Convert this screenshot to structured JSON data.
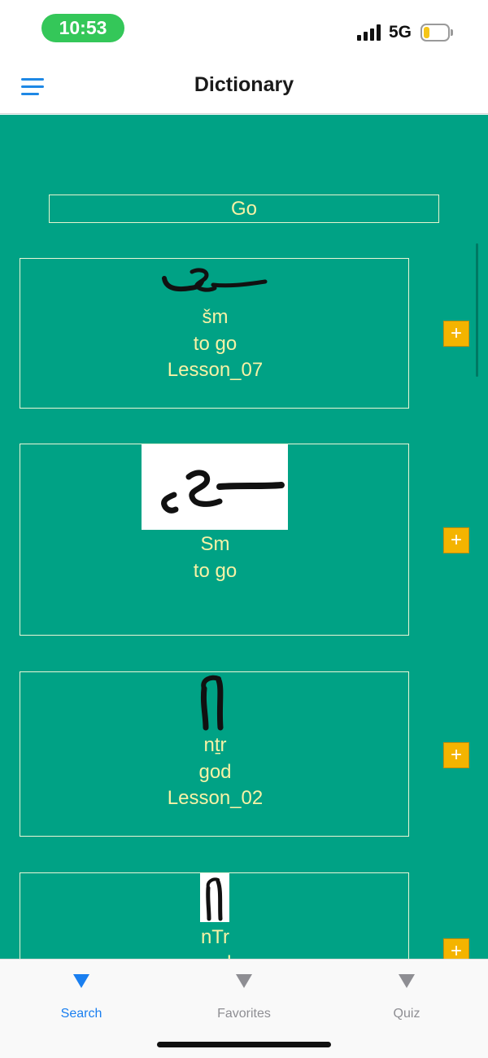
{
  "status": {
    "time": "10:53",
    "network": "5G",
    "battery_level": 0.2
  },
  "nav": {
    "title": "Dictionary"
  },
  "search": {
    "value": "Go"
  },
  "entries": [
    {
      "translit": "šm",
      "meaning": "to go",
      "lesson": "Lesson_07",
      "glyph": "hieratic-sm-glyph"
    },
    {
      "translit": "Sm",
      "meaning": "to go",
      "lesson": "",
      "glyph": "hieratic-sm-scan-glyph"
    },
    {
      "translit": "nṯr",
      "meaning": "god",
      "lesson": "Lesson_02",
      "glyph": "hieratic-ntr-glyph"
    },
    {
      "translit": "nTr",
      "meaning": "god",
      "lesson": "",
      "glyph": "hieratic-ntr-scan-glyph"
    }
  ],
  "add_label": "+",
  "tabs": [
    {
      "label": "Search",
      "active": true
    },
    {
      "label": "Favorites",
      "active": false
    },
    {
      "label": "Quiz",
      "active": false
    }
  ],
  "colors": {
    "content_bg": "#00a285",
    "text": "#f7f2a6",
    "add_button": "#f4b400",
    "active_tab": "#1a7ff0"
  }
}
